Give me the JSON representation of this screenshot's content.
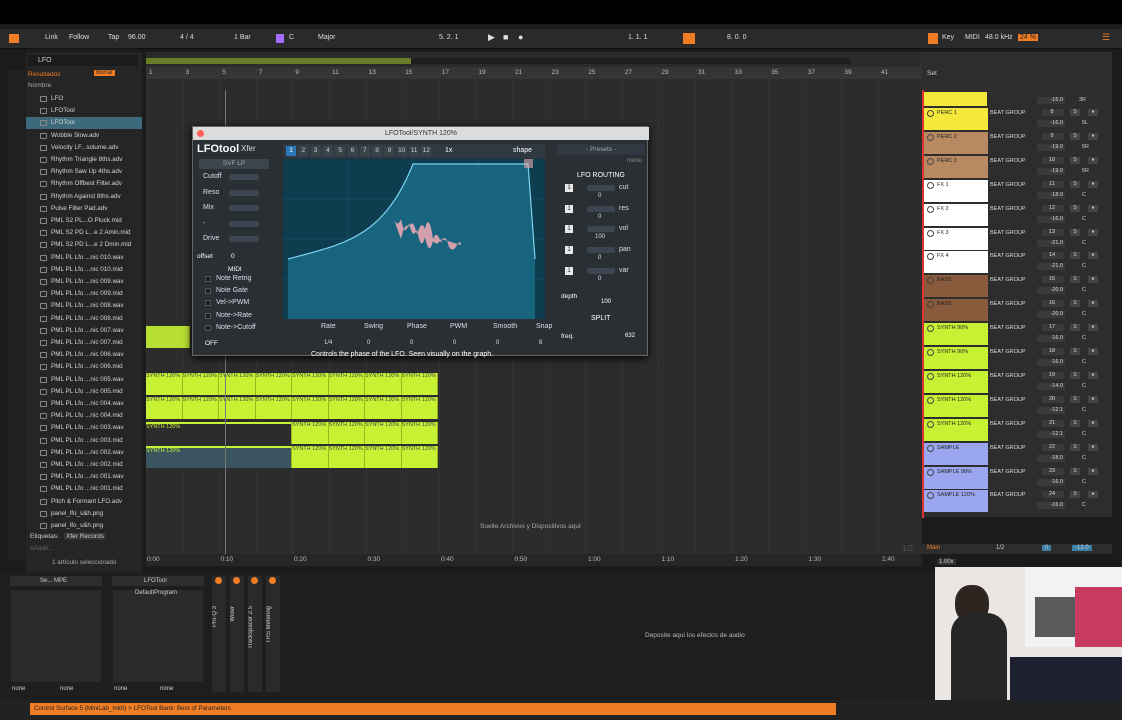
{
  "transport": {
    "link": "Link",
    "follow": "Follow",
    "tap": "Tap",
    "tempo": "96.00",
    "sig": "4 / 4",
    "quant": "1 Bar",
    "key": "C",
    "scale": "Major",
    "position": "5.  2.  1",
    "loop_start": "1.  1.  1",
    "loop_len": "8.  0.  0",
    "key_label": "Key",
    "midi": "MIDI",
    "rate": "48.0 kHz",
    "cpu": "24 %"
  },
  "browser": {
    "search": "LFO",
    "results": "Resultados",
    "erase": "Borrar",
    "name_col": "Nombre",
    "items": [
      "LFO",
      "LFOTool",
      "LFOTool",
      "Wobble Slow.adv",
      "Velocity LF...solume.adv",
      "Rhythm Triangle 8ths.adv",
      "Rhythm Saw Up 4ths.adv",
      "Rhythm Offbest Filter.adv",
      "Rhythm Against 8ths.adv",
      "Pulse Filter Pad.adv",
      "PML S2 PL...O Pluck.mid",
      "PML S2 PD L...e 2 Amin.mid",
      "PML S2 PD L...e 2 Dmin.mid",
      "PML PL Lfo ...nic 010.wav",
      "PML PL Lfo ...nic 010.mid",
      "PML PL Lfo ...nic 009.wav",
      "PML PL Lfo ...nic 009.mid",
      "PML PL Lfo ...nic 008.wav",
      "PML PL Lfo ...nic 008.mid",
      "PML PL Lfo ...nic 007.wav",
      "PML PL Lfo ...nic 007.mid",
      "PML PL Lfo ...nic 006.wav",
      "PML PL Lfo ...nic 006.mid",
      "PML PL Lfo ...nic 005.wav",
      "PML PL Lfo ...nic 005.mid",
      "PML PL Lfo ...nic 004.wav",
      "PML PL Lfo ...nic 004.mid",
      "PML PL Lfo ...nic 003.wav",
      "PML PL Lfo ...nic 003.mid",
      "PML PL Lfo ...nic 002.wav",
      "PML PL Lfo ...nic 002.mid",
      "PML PL Lfo ...nic 001.wav",
      "PML PL Lfo ...nic 001.mid",
      "Pitch & Formant LFO.adv",
      "panel_lfo_s&h.png",
      "panel_lfo_s&h.png"
    ],
    "tags": "Etiquetas:",
    "tag_value": "Xfer Records",
    "add": "Añadir...",
    "selected": "1 artículo seleccionado"
  },
  "ruler": [
    "1",
    "3",
    "5",
    "7",
    "9",
    "11",
    "13",
    "15",
    "17",
    "19",
    "21",
    "23",
    "25",
    "27",
    "29",
    "31",
    "33",
    "35",
    "37",
    "39",
    "41"
  ],
  "timeline": [
    "0:00",
    "0:10",
    "0:20",
    "0:30",
    "0:40",
    "0:50",
    "1:00",
    "1:10",
    "1:20",
    "1:30",
    "1:40"
  ],
  "clips": {
    "synth": "SYNTH 120%"
  },
  "drop_hint": "Suelte Archivos y Dispositivos aquí",
  "mixer": {
    "set": "Set",
    "group": "BEAT GROUP",
    "tracks": [
      {
        "name": "PERC 1",
        "color": "#f6e83a",
        "num": "8",
        "vol": "-16.0",
        "pan": "5L"
      },
      {
        "name": "PERC 2",
        "color": "#b98a62",
        "num": "9",
        "vol": "-19.0",
        "pan": "5R"
      },
      {
        "name": "PERC 3",
        "color": "#b98a62",
        "num": "10",
        "vol": "-19.0",
        "pan": "5R"
      },
      {
        "name": "FX 1",
        "color": "#ffffff",
        "num": "11",
        "vol": "-18.0",
        "pan": "C"
      },
      {
        "name": "FX 2",
        "color": "#ffffff",
        "num": "12",
        "vol": "-16.0",
        "pan": "C"
      },
      {
        "name": "FX 3",
        "color": "#ffffff",
        "num": "13",
        "vol": "-21.0",
        "pan": "C"
      },
      {
        "name": "FX 4",
        "color": "#ffffff",
        "num": "14",
        "vol": "-21.0",
        "pan": "C"
      },
      {
        "name": "BASS",
        "color": "#8a5a3c",
        "num": "15",
        "vol": "-20.0",
        "pan": "C"
      },
      {
        "name": "BASS",
        "color": "#8a5a3c",
        "num": "16",
        "vol": "-20.0",
        "pan": "C"
      },
      {
        "name": "SYNTH 90%",
        "color": "#c7f234",
        "num": "17",
        "vol": "-16.0",
        "pan": "C"
      },
      {
        "name": "SYNTH 90%",
        "color": "#c7f234",
        "num": "18",
        "vol": "-16.0",
        "pan": "C"
      },
      {
        "name": "SYNTH 120%",
        "color": "#c7f234",
        "num": "19",
        "vol": "-14.0",
        "pan": "C"
      },
      {
        "name": "SYNTH 120%",
        "color": "#c7f234",
        "num": "20",
        "vol": "-12.1",
        "pan": "C"
      },
      {
        "name": "SYNTH 120%",
        "color": "#c7f234",
        "num": "21",
        "vol": "-12.1",
        "pan": "C"
      },
      {
        "name": "SAMPLE",
        "color": "#9aa6f0",
        "num": "22",
        "vol": "-18.0",
        "pan": "C"
      },
      {
        "name": "SAMPLE 90%",
        "color": "#9aa6f0",
        "num": "23",
        "vol": "-16.0",
        "pan": "C"
      },
      {
        "name": "SAMPLE 120%",
        "color": "#9aa6f0",
        "num": "24",
        "vol": "-16.0",
        "pan": "C"
      }
    ],
    "top_vol": "-15.0",
    "top_pan": "3R",
    "main": "Main",
    "main_frac": "1/2",
    "main_vol": "0",
    "main_db": "-12.0",
    "frac": "1/2",
    "zoom": "1.00x"
  },
  "plugin": {
    "title": "LFOTool/SYNTH 120%",
    "logo": "LFOtool",
    "brand": "Xfer",
    "filter": "SVF LP",
    "graphs": [
      "1",
      "2",
      "3",
      "4",
      "5",
      "6",
      "7",
      "8",
      "9",
      "10",
      "11",
      "12"
    ],
    "mult": "1x",
    "shape": "shape",
    "presets": "- Presets -",
    "menu": "menu",
    "routing": "LFO ROUTING",
    "routes": [
      {
        "n": "1",
        "lbl": "cut",
        "v": "0"
      },
      {
        "n": "1",
        "lbl": "res",
        "v": "0"
      },
      {
        "n": "1",
        "lbl": "vol",
        "v": "100"
      },
      {
        "n": "1",
        "lbl": "pan",
        "v": "0"
      },
      {
        "n": "1",
        "lbl": "var",
        "v": "0"
      }
    ],
    "params": [
      "Cutoff",
      "Reso",
      "Mix",
      "-",
      "Drive"
    ],
    "offset": "offset",
    "offset_val": "0",
    "midi": "MIDI",
    "midi_opts": [
      "Note Retrig",
      "Note Gate",
      "Vel->PWM",
      "Note->Rate",
      "Note->Cutoff"
    ],
    "off": "OFF",
    "depth": "depth",
    "depth_val": "100",
    "split": "SPLIT",
    "freq": "freq.",
    "freq_val": "632",
    "bottom": [
      "Rate",
      "Swing",
      "Phase",
      "PWM",
      "Smooth",
      "Snap"
    ],
    "bottom_vals": [
      "1/4",
      "0",
      "0",
      "0",
      "0",
      "8"
    ],
    "hint": "Controls the phase of the LFO. Seen visually on the graph."
  },
  "devices": {
    "d1": "Se... MPE",
    "d2": "LFOTool",
    "program": "DefaultProgram",
    "none": "none",
    "vert": [
      "Pro-Q 3",
      "Wider",
      "Trackspacer 2.5",
      "TRS Metering"
    ],
    "drop": "Deposite aquí los efectos de audio"
  },
  "status": "Control Surface 5 (MiniLab_mkII) > LFOTool Bank: Best of Parameters",
  "colors": {
    "accent": "#f07d24",
    "clip": "#c7f234",
    "graph": "#1b6d8a"
  }
}
